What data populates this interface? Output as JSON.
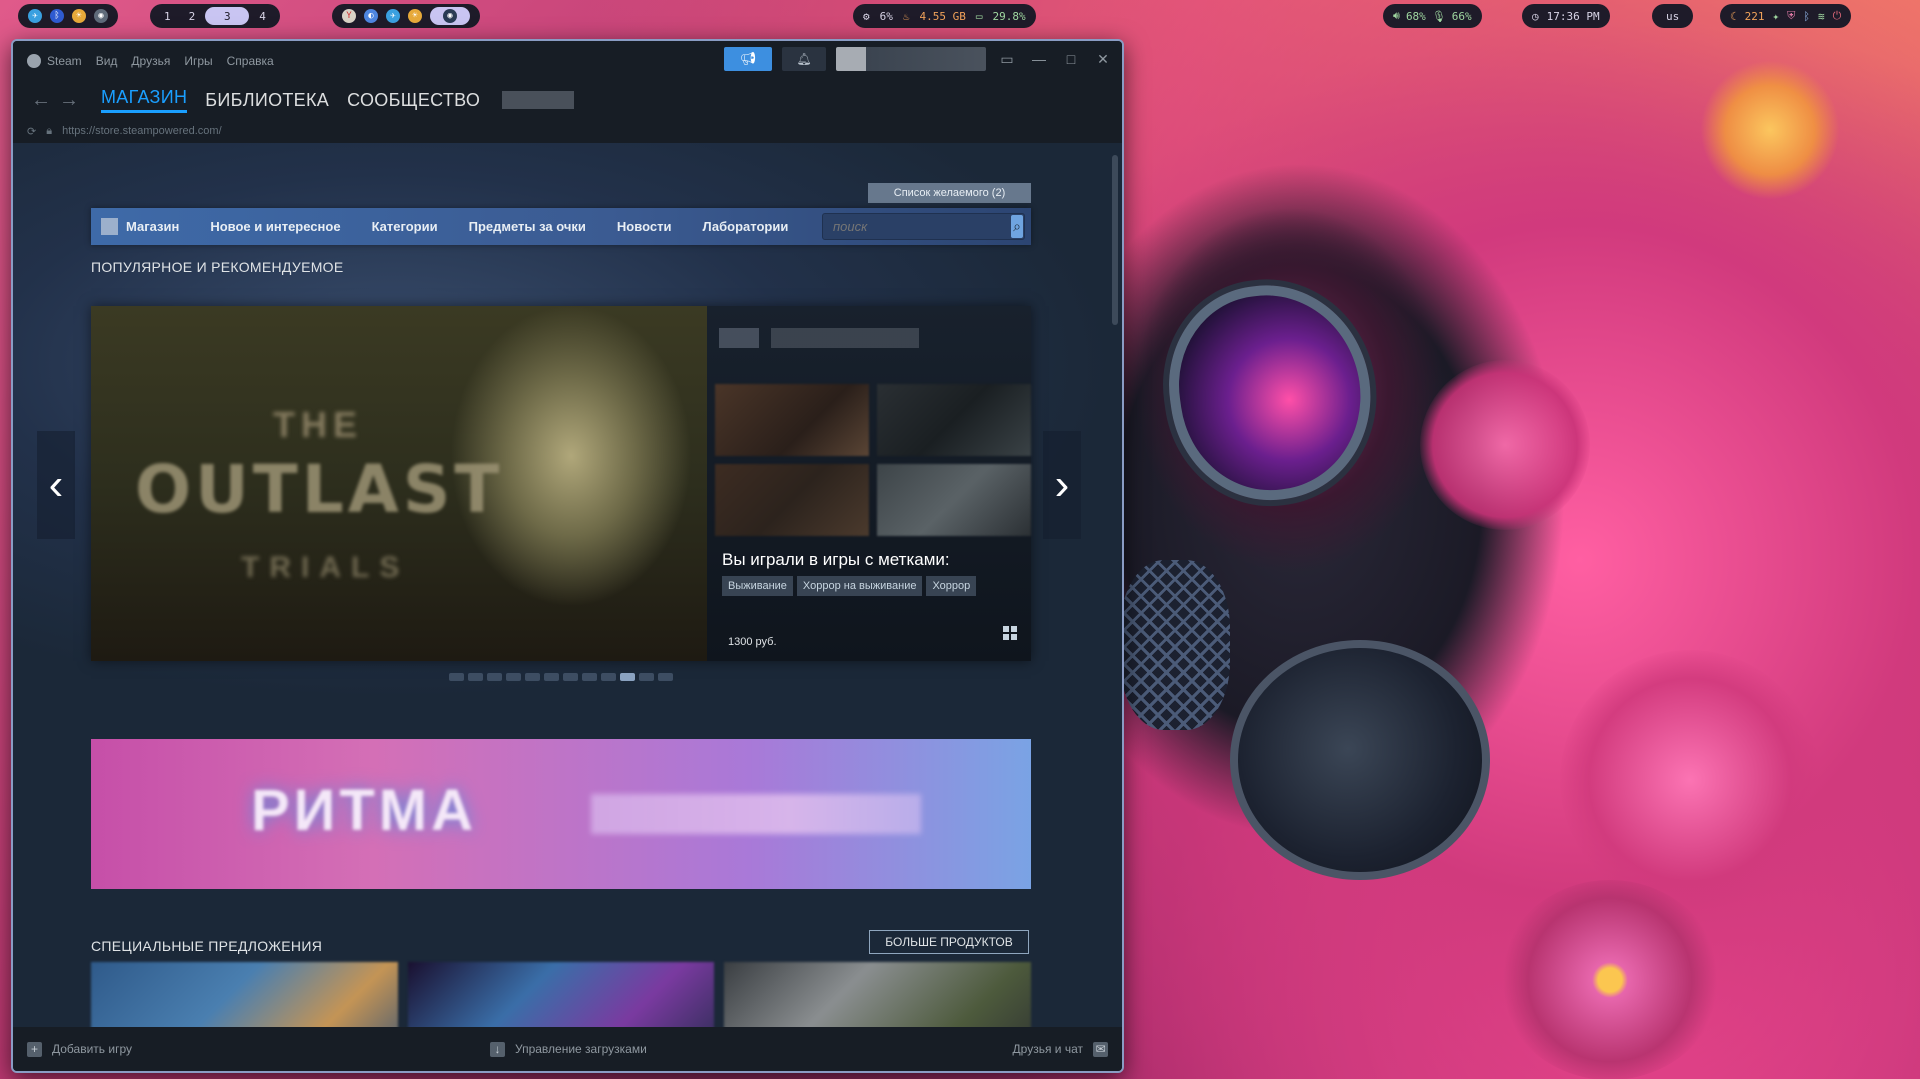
{
  "topbar": {
    "workspaces": [
      "1",
      "2",
      "3",
      "4"
    ],
    "active_workspace": "3",
    "system": {
      "cpu": "6%",
      "memory": "4.55 GB",
      "battery": "29.8%"
    },
    "audio": {
      "volume": "68%",
      "mic": "66%"
    },
    "clock": "17:36 PM",
    "keyboard_layout": "us",
    "notifications": "221"
  },
  "steam": {
    "menu": [
      "Steam",
      "Вид",
      "Друзья",
      "Игры",
      "Справка"
    ],
    "tabs": [
      "МАГАЗИН",
      "БИБЛИОТЕКА",
      "СООБЩЕСТВО"
    ],
    "active_tab": "МАГАЗИН",
    "url": "https://store.steampowered.com/",
    "wishlist_button": "Список желаемого (2)",
    "store_nav": [
      "Магазин",
      "Новое и интересное",
      "Категории",
      "Предметы за очки",
      "Новости",
      "Лаборатории"
    ],
    "search_placeholder": "поиск",
    "featured": {
      "section_title": "ПОПУЛЯРНОЕ И РЕКОМЕНДУЕМОЕ",
      "game_logo_line1": "THE",
      "game_logo_line2": "OUTLAST",
      "game_logo_line3": "TRIALS",
      "reason": "Вы играли в игры с метками:",
      "tags": [
        "Выживание",
        "Хоррор на выживание",
        "Хоррор"
      ],
      "price": "1300 руб.",
      "slide_count": 12,
      "active_slide": 10
    },
    "banner": {
      "title": "РИТМА"
    },
    "specials": {
      "section_title": "СПЕЦИАЛЬНЫЕ ПРЕДЛОЖЕНИЯ",
      "more_button": "БОЛЬШЕ ПРОДУКТОВ"
    },
    "footer": {
      "add_game": "Добавить игру",
      "downloads": "Управление загрузками",
      "friends": "Друзья и чат"
    }
  },
  "colors": {
    "accent": "#1a9fff",
    "steam_bg": "#1b2838",
    "window_border": "#8a9cc4"
  }
}
